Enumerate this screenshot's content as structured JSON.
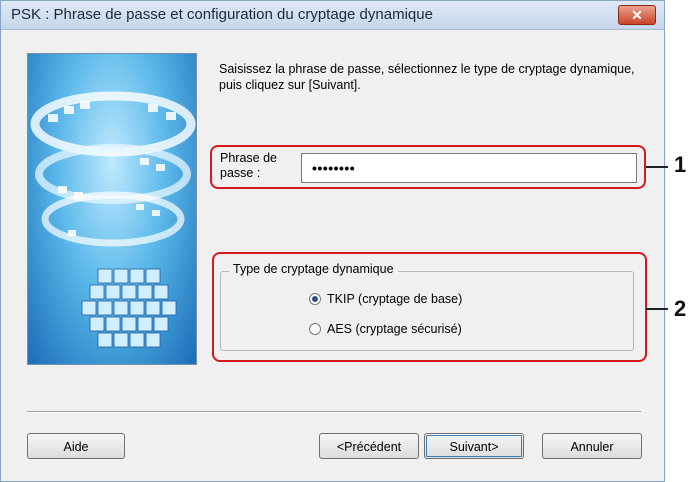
{
  "window": {
    "title": "PSK : Phrase de passe et configuration du cryptage dynamique",
    "close_label": "✕"
  },
  "instruction": "Saisissez la phrase de passe, sélectionnez le type de cryptage dynamique, puis cliquez sur [Suivant].",
  "passphrase": {
    "label": "Phrase de passe :",
    "value": "••••••••"
  },
  "encryption": {
    "group_label": "Type de cryptage dynamique",
    "options": [
      {
        "label": "TKIP (cryptage de base)",
        "selected": true
      },
      {
        "label": "AES (cryptage sécurisé)",
        "selected": false
      }
    ]
  },
  "callouts": [
    "1",
    "2"
  ],
  "buttons": {
    "help": "Aide",
    "previous": "<Précédent",
    "next": "Suivant>",
    "cancel": "Annuler"
  },
  "colors": {
    "callout": "#d21a1a",
    "titlebar": "#c5d6ea",
    "close": "#c8452a"
  }
}
